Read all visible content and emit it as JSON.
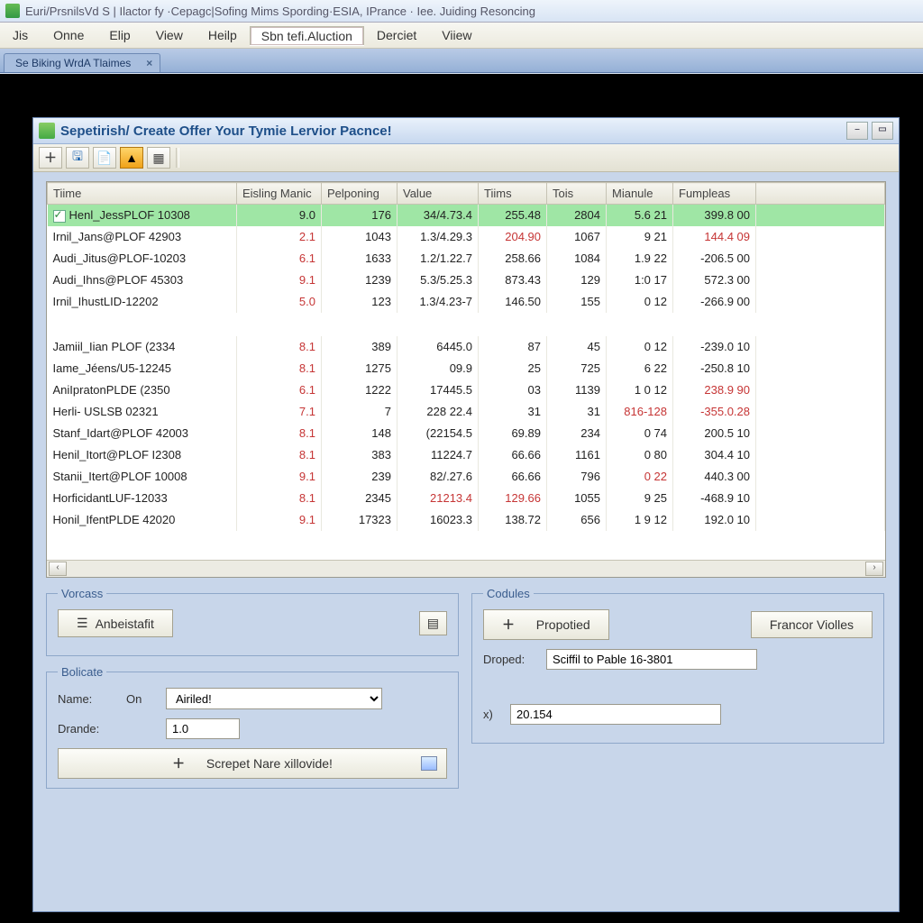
{
  "app": {
    "title": "Euri/PrsnilsVd S | Ilactor fy ·Cepagc|Sofing Mims Spording·ESIA, IPrance · Iee. Juiding Resoncing"
  },
  "menubar": [
    "Jis",
    "Onne",
    "Elip",
    "View",
    "Heilp",
    "Sbn tefi.Aluction",
    "Derciet",
    "Viiew"
  ],
  "tabs": [
    "Se Biking WrdA Tlaimes"
  ],
  "child": {
    "title": "Sepetirish/ Create Offer Your Tymie Lervior Pacnce!"
  },
  "grid": {
    "columns": [
      "Tiime",
      "Eisling Manic",
      "Pelponing",
      "Value",
      "Tiims",
      "Tois",
      "Mianule",
      "Fumpleas",
      ""
    ],
    "rows": [
      {
        "sel": true,
        "chk": true,
        "c": [
          "Henl_JessPLOF 10308",
          "9.0",
          "176",
          "34/4.73.4",
          "255.48",
          "2804",
          "5.6  21",
          "399.8 00"
        ]
      },
      {
        "c": [
          "Irnil_Jans@PLOF 42903",
          "2.1",
          "1043",
          "1.3/4.29.3",
          "204.90",
          "1067",
          "9  21",
          "144.4 09"
        ],
        "red": [
          1,
          4,
          7
        ]
      },
      {
        "c": [
          "Audi_Jitus@PLOF-10203",
          "6.1",
          "1633",
          "1.2/1.22.7",
          "258.66",
          "1084",
          "1.9  22",
          "-206.5 00"
        ],
        "red": [
          1
        ]
      },
      {
        "c": [
          "Audi_Ihns@PLOF 45303",
          "9.1",
          "1239",
          "5.3/5.25.3",
          "873.43",
          "129",
          "1:0  17",
          "572.3 00"
        ],
        "red": [
          1
        ]
      },
      {
        "c": [
          "Irnil_IhustLID-12202",
          "5.0",
          "123",
          "1.3/4.23-7",
          "146.50",
          "155",
          "0  12",
          "-266.9 00"
        ],
        "red": [
          1
        ]
      },
      {
        "gap": true
      },
      {
        "c": [
          "Jamiil_Iian PLOF (2334",
          "8.1",
          "389",
          "6445.0",
          "87",
          "45",
          "0  12",
          "-239.0 10"
        ],
        "red": [
          1
        ]
      },
      {
        "c": [
          "Iame_Jéens/U5-12245",
          "8.1",
          "1275",
          "09.9",
          "25",
          "725",
          "6  22",
          "-250.8 10"
        ],
        "red": [
          1
        ]
      },
      {
        "c": [
          "AniIpratonPLDE (2350",
          "6.1",
          "1222",
          "17445.5",
          "03",
          "1139",
          "1 0  12",
          "238.9 90"
        ],
        "red": [
          1,
          7
        ]
      },
      {
        "c": [
          "Herli- USLSB 02321",
          "7.1",
          "7",
          "228 22.4",
          "31",
          "31",
          "816-128",
          "-355.0.28"
        ],
        "red": [
          1,
          6,
          7
        ]
      },
      {
        "c": [
          "Stanf_Idart@PLOF 42003",
          "8.1",
          "148",
          "(22154.5",
          "69.89",
          "234",
          "0  74",
          "200.5 10"
        ],
        "red": [
          1
        ]
      },
      {
        "c": [
          "Henil_Itort@PLOF I2308",
          "8.1",
          "383",
          "11224.7",
          "66.66",
          "1161",
          "0  80",
          "304.4 10"
        ],
        "red": [
          1
        ]
      },
      {
        "c": [
          "Stanii_Itert@PLOF 10008",
          "9.1",
          "239",
          "82/.27.6",
          "66.66",
          "796",
          "0  22",
          "440.3 00"
        ],
        "red": [
          1,
          6
        ]
      },
      {
        "c": [
          "HorficidantLUF-12033",
          "8.1",
          "2345",
          "21213.4",
          "129.66",
          "1055",
          "9  25",
          "-468.9 10"
        ],
        "red": [
          1,
          3,
          4
        ]
      },
      {
        "c": [
          "Honil_IfentPLDE 42020",
          "9.1",
          "17323",
          "16023.3",
          "138.72",
          "656",
          "1 9  12",
          "192.0 10"
        ],
        "red": [
          1
        ]
      }
    ]
  },
  "panels": {
    "left": {
      "group1": {
        "title": "Vorcass",
        "button": "Anbeistafit"
      },
      "group2": {
        "title": "Bolicate",
        "name_label": "Name:",
        "on_label": "On",
        "name_value": "Airiled!",
        "drande_label": "Drande:",
        "drande_value": "1.0",
        "script_button": "Screpet Nare xillovide!"
      }
    },
    "right": {
      "title": "Codules",
      "btn1": "Propotied",
      "btn2": "Francor Violles",
      "droped_label": "Droped:",
      "droped_value": "Sciffil to Pable 16-3801",
      "x_label": "x)",
      "x_value": "20.154"
    }
  }
}
